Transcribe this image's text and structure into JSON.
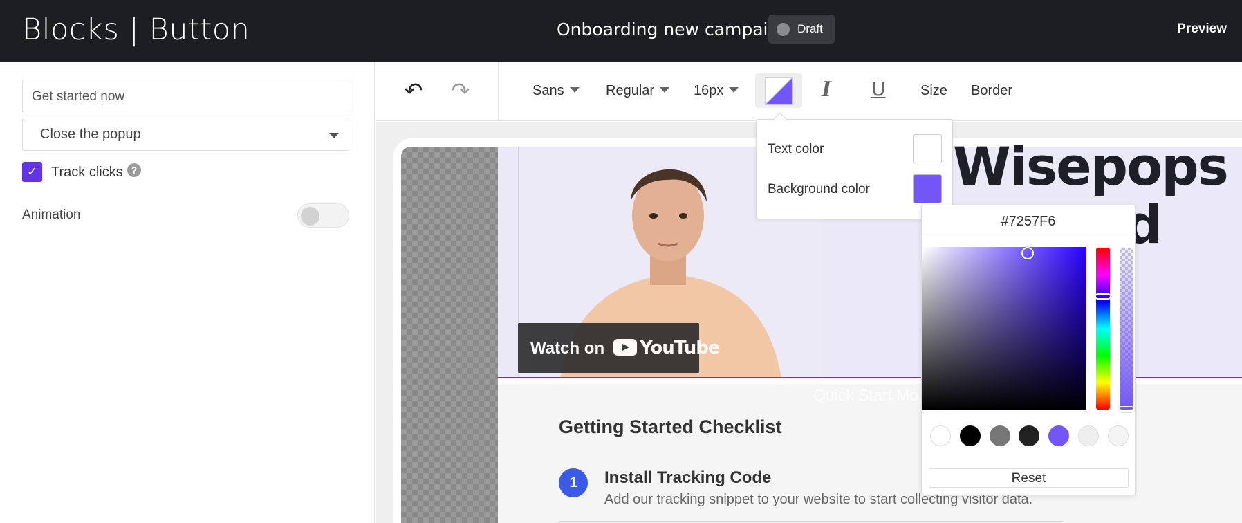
{
  "header": {
    "app_title": "Blocks | Button",
    "campaign_name": "Onboarding new campaign",
    "status": "Draft",
    "preview": "Preview"
  },
  "left_panel": {
    "button_text_value": "Get started now",
    "action_select_value": "Close the popup",
    "track_clicks_label": "Track clicks",
    "track_clicks_checked": true,
    "animation_label": "Animation",
    "animation_enabled": false
  },
  "toolbar": {
    "font_family": "Sans",
    "font_weight": "Regular",
    "font_size": "16px",
    "size_label": "Size",
    "border_label": "Border"
  },
  "color_popover": {
    "text_color_label": "Text color",
    "text_color": "#FFFFFF",
    "background_color_label": "Background color",
    "background_color": "#7257F6"
  },
  "color_picker": {
    "hex_value": "#7257F6",
    "presets": [
      "#FFFFFF",
      "#000000",
      "#777777",
      "#222222",
      "#7257F6",
      "#EEEEEE",
      "#F4F4F4"
    ],
    "reset_label": "Reset"
  },
  "canvas": {
    "video_watch_label": "Watch on",
    "video_brand": "YouTube",
    "heading_line1": "Wisepops",
    "heading_line2": "ard",
    "overlay_text": "Quick Start Mo",
    "checklist_title": "Getting Started Checklist",
    "steps": [
      {
        "number": "1",
        "title": "Install Tracking Code",
        "description": "Add our tracking snippet to your website to start collecting visitor data."
      }
    ]
  },
  "colors": {
    "accent": "#6233E8",
    "step_badge": "#3B5BE6",
    "header_bg": "#1D1E22"
  }
}
